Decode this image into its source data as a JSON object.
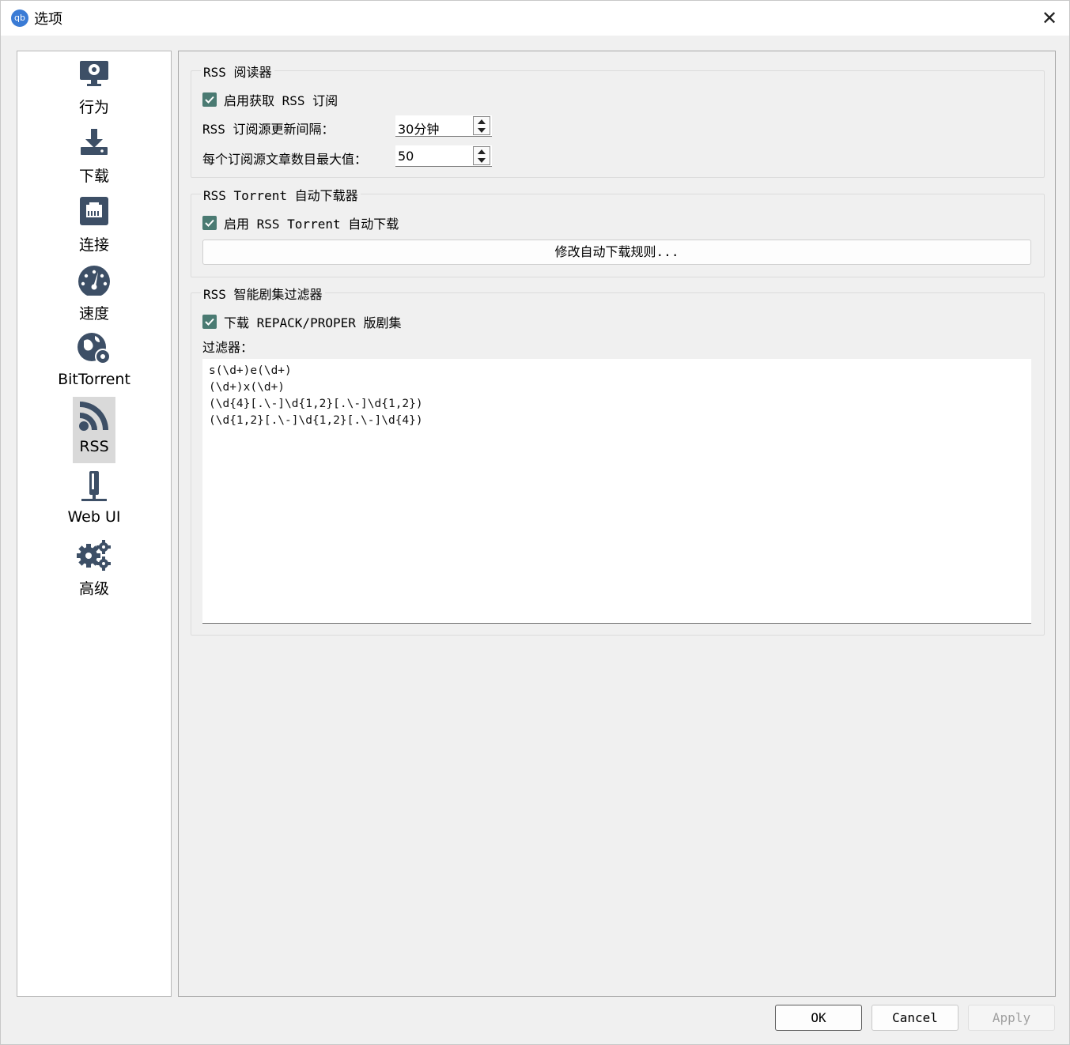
{
  "window": {
    "app_icon_text": "qb",
    "title": "选项",
    "close_glyph": "✕"
  },
  "sidebar": {
    "items": [
      {
        "label": "行为",
        "icon": "behavior-monitor-icon"
      },
      {
        "label": "下载",
        "icon": "download-icon"
      },
      {
        "label": "连接",
        "icon": "connection-icon"
      },
      {
        "label": "速度",
        "icon": "speedometer-icon"
      },
      {
        "label": "BitTorrent",
        "icon": "globe-gear-icon"
      },
      {
        "label": "RSS",
        "icon": "rss-icon",
        "selected": true
      },
      {
        "label": "Web UI",
        "icon": "web-ui-icon"
      },
      {
        "label": "高级",
        "icon": "gears-icon"
      }
    ]
  },
  "rss_reader": {
    "title": "RSS 阅读器",
    "enable_label": "启用获取 RSS 订阅",
    "enable_checked": true,
    "interval_label": "RSS 订阅源更新间隔：",
    "interval_value": "30分钟",
    "max_articles_label": "每个订阅源文章数目最大值：",
    "max_articles_value": "50"
  },
  "auto_downloader": {
    "title": "RSS Torrent 自动下载器",
    "enable_label": "启用 RSS Torrent 自动下载",
    "enable_checked": true,
    "edit_rules_label": "修改自动下载规则..."
  },
  "smart_filter": {
    "title": "RSS 智能剧集过滤器",
    "repack_label": "下载 REPACK/PROPER 版剧集",
    "repack_checked": true,
    "filters_label": "过滤器：",
    "filters": [
      "s(\\d+)e(\\d+)",
      "(\\d+)x(\\d+)",
      "(\\d{4}[.\\-]\\d{1,2}[.\\-]\\d{1,2})",
      "(\\d{1,2}[.\\-]\\d{1,2}[.\\-]\\d{4})"
    ]
  },
  "buttons": {
    "ok": "OK",
    "cancel": "Cancel",
    "apply": "Apply"
  },
  "colors": {
    "checkbox": "#4a7a72",
    "icon": "#3d4f66",
    "selected_nav": "#d9d9d9"
  }
}
